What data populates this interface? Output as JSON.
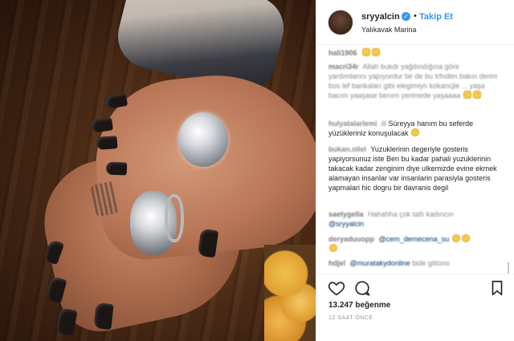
{
  "post": {
    "username": "sryyalcin",
    "verified_mark": "✓",
    "separator": "•",
    "follow_label": "Takip Et",
    "location": "Yalıkavak Marina"
  },
  "comments": [
    {
      "user": "hali1906",
      "text": "",
      "emoji": [
        "clap-emoji",
        "clap-emoji"
      ],
      "blurred": true
    },
    {
      "user": "macri34r",
      "text": "Allah bukdr yağdındığına göre yardımlarını yapıyordur bir de bu trfnden bakın derim bos lef bankaları gibi elegimiyn kokancjle ... yaşa bacım yaaşase benım yerimede yaşaaaa",
      "emoji": [
        "clap-emoji",
        "clap-emoji"
      ],
      "blurred": true
    },
    {
      "user": "hulyatalarlemi",
      "pre": ".lil",
      "text": "Süreyya hanım bu seferde yüzükleriniz konuşulacak",
      "emoji": [
        "laugh-emoji"
      ],
      "blurred": false
    },
    {
      "user": "bukan.oliel",
      "text": "Yuzuklerinin degeriyle gosteris yapiyorsunuz iste Ben bu kadar pahali yuzuklerinin takacak kadar zenginim diye ulkemizde evine ekmek alamayan insanlar var insanlarin parasiyla gosteris yapmalari hic dogru bir davranis degil",
      "emoji": [],
      "blurred": false
    },
    {
      "user": "saetygella",
      "text": "Hahahha çok tatlı kadıncın",
      "mention": "@sryyalcin",
      "emoji": [],
      "blurred": true
    },
    {
      "user": "deryaduuopp",
      "text": "",
      "mention": "@cem_demecena_su",
      "emoji": [
        "laugh-emoji",
        "laugh-emoji",
        "laugh-emoji"
      ],
      "blurred": true
    },
    {
      "user": "hdjel",
      "text": "bide gittono",
      "mention": "@muratakydonline",
      "emoji": [],
      "blurred": true
    }
  ],
  "likes_text": "13.247 beğenme",
  "time_text": "12 SAAT ÖNCE",
  "colors": {
    "accent": "#3897f0",
    "text": "#262626",
    "muted": "#999999"
  },
  "icons": [
    "heart-icon",
    "comment-icon",
    "bookmark-icon",
    "verified-badge-icon"
  ]
}
